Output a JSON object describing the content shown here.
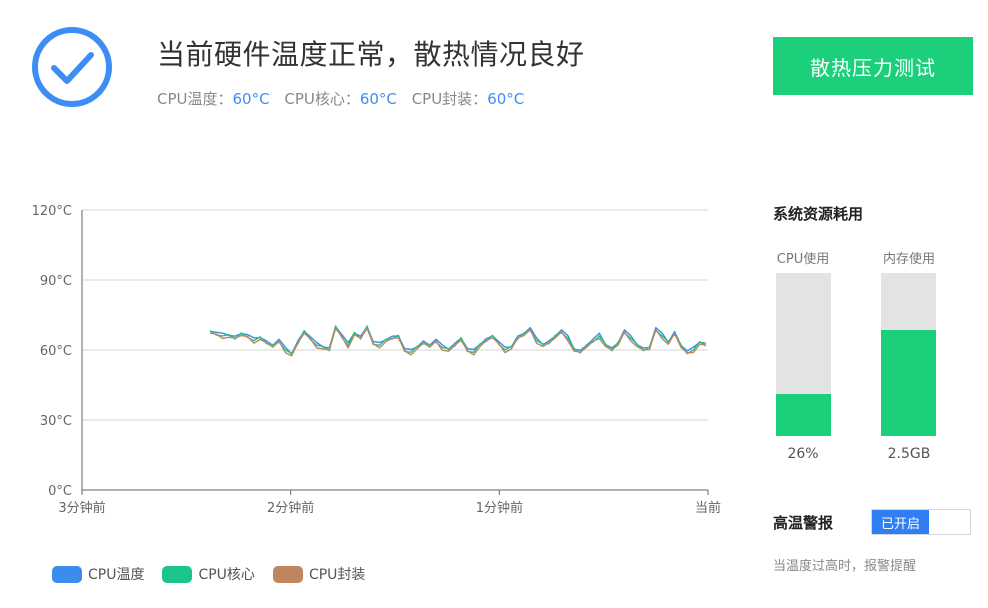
{
  "header": {
    "title": "当前硬件温度正常，散热情况良好",
    "temps": [
      {
        "label": "CPU温度：",
        "value": "60°C"
      },
      {
        "label": "CPU核心：",
        "value": "60°C"
      },
      {
        "label": "CPU封装：",
        "value": "60°C"
      }
    ],
    "stress_test_label": "散热压力测试",
    "accent_color": "#1bcf7b",
    "icon": "check-circle-icon"
  },
  "chart_data": {
    "type": "line",
    "ylim": [
      0,
      120
    ],
    "y_ticks": [
      "0°C",
      "30°C",
      "60°C",
      "90°C",
      "120°C"
    ],
    "x_ticks": [
      "3分钟前",
      "2分钟前",
      "1分钟前",
      "当前"
    ],
    "grid": true,
    "legend_position": "bottom-left",
    "base_series": [
      68,
      67,
      66,
      66,
      65,
      67,
      66,
      64,
      65,
      63,
      62,
      64,
      60,
      58,
      63,
      68,
      65,
      62,
      61,
      60,
      70,
      66,
      62,
      67,
      65,
      70,
      63,
      62,
      64,
      65,
      66,
      60,
      59,
      61,
      63,
      62,
      64,
      61,
      60,
      62,
      65,
      60,
      59,
      62,
      64,
      66,
      63,
      60,
      61,
      65,
      67,
      69,
      64,
      62,
      63,
      66,
      68,
      65,
      60,
      59,
      62,
      64,
      66,
      62,
      60,
      63,
      68,
      65,
      62,
      60,
      61,
      69,
      66,
      63,
      67,
      62,
      59,
      60,
      63,
      62
    ],
    "series": [
      {
        "name": "CPU温度",
        "color": "#3b8ced",
        "offset": 0.6
      },
      {
        "name": "CPU核心",
        "color": "#1bc489",
        "offset": 0
      },
      {
        "name": "CPU封装",
        "color": "#c0855f",
        "offset": -0.5
      }
    ]
  },
  "resources": {
    "title": "系统资源耗用",
    "cpu": {
      "label": "CPU使用",
      "value": "26%",
      "fraction": 0.26
    },
    "memory": {
      "label": "内存使用",
      "value": "2.5GB",
      "fraction": 0.65
    }
  },
  "alarm": {
    "label": "高温警报",
    "toggle_label": "已开启",
    "description": "当温度过高时，报警提醒"
  }
}
